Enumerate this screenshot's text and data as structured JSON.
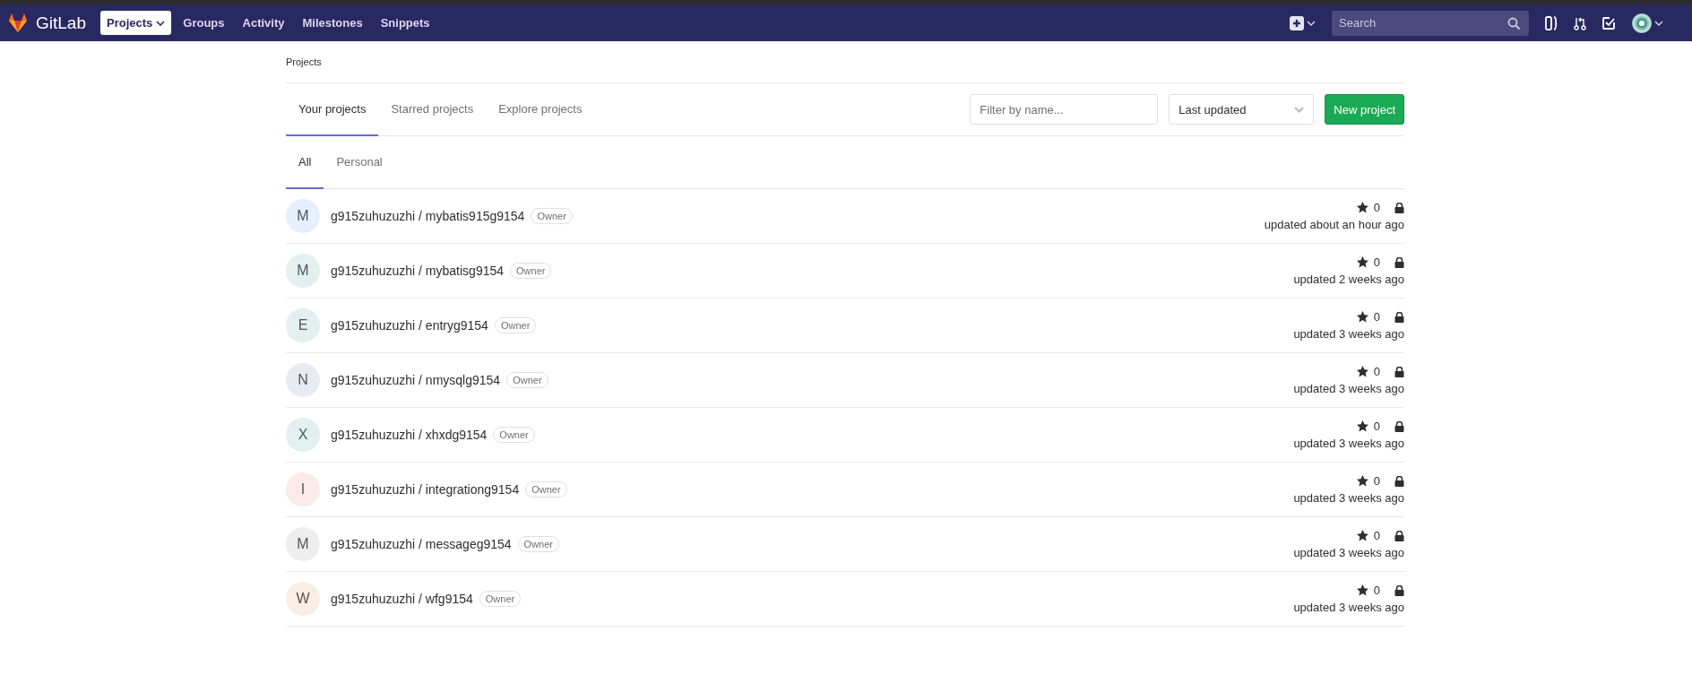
{
  "navbar": {
    "brand": "GitLab",
    "links": [
      {
        "label": "Projects",
        "selected": true,
        "dropdown": true
      },
      {
        "label": "Groups",
        "selected": false,
        "dropdown": false
      },
      {
        "label": "Activity",
        "selected": false,
        "dropdown": false
      },
      {
        "label": "Milestones",
        "selected": false,
        "dropdown": false
      },
      {
        "label": "Snippets",
        "selected": false,
        "dropdown": false
      }
    ],
    "search": {
      "placeholder": "Search"
    }
  },
  "breadcrumb": "Projects",
  "tabs": [
    {
      "label": "Your projects",
      "selected": true
    },
    {
      "label": "Starred projects",
      "selected": false
    },
    {
      "label": "Explore projects",
      "selected": false
    }
  ],
  "filter": {
    "placeholder": "Filter by name..."
  },
  "sort": {
    "value": "Last updated"
  },
  "new_project_button": "New project",
  "subtabs": [
    {
      "label": "All",
      "selected": true
    },
    {
      "label": "Personal",
      "selected": false
    }
  ],
  "projects": [
    {
      "initial": "M",
      "color": "#e5effd",
      "name": "g915zuhuzuzhi / mybatis915g9154",
      "role": "Owner",
      "stars": "0",
      "private": true,
      "updated": "updated about an hour ago"
    },
    {
      "initial": "M",
      "color": "#e2f0ef",
      "name": "g915zuhuzuzhi / mybatisg9154",
      "role": "Owner",
      "stars": "0",
      "private": true,
      "updated": "updated 2 weeks ago"
    },
    {
      "initial": "E",
      "color": "#e2f0ef",
      "name": "g915zuhuzuzhi / entryg9154",
      "role": "Owner",
      "stars": "0",
      "private": true,
      "updated": "updated 3 weeks ago"
    },
    {
      "initial": "N",
      "color": "#eaeaf3",
      "name": "g915zuhuzuzhi / nmysqlg9154",
      "role": "Owner",
      "stars": "0",
      "private": true,
      "updated": "updated 3 weeks ago"
    },
    {
      "initial": "X",
      "color": "#e2f0ef",
      "name": "g915zuhuzuzhi / xhxdg9154",
      "role": "Owner",
      "stars": "0",
      "private": true,
      "updated": "updated 3 weeks ago"
    },
    {
      "initial": "I",
      "color": "#fbeaea",
      "name": "g915zuhuzuzhi / integrationg9154",
      "role": "Owner",
      "stars": "0",
      "private": true,
      "updated": "updated 3 weeks ago"
    },
    {
      "initial": "M",
      "color": "#eeeeee",
      "name": "g915zuhuzuzhi / messageg9154",
      "role": "Owner",
      "stars": "0",
      "private": true,
      "updated": "updated 3 weeks ago"
    },
    {
      "initial": "W",
      "color": "#f8eee4",
      "name": "g915zuhuzuzhi / wfg9154",
      "role": "Owner",
      "stars": "0",
      "private": true,
      "updated": "updated 3 weeks ago"
    }
  ]
}
